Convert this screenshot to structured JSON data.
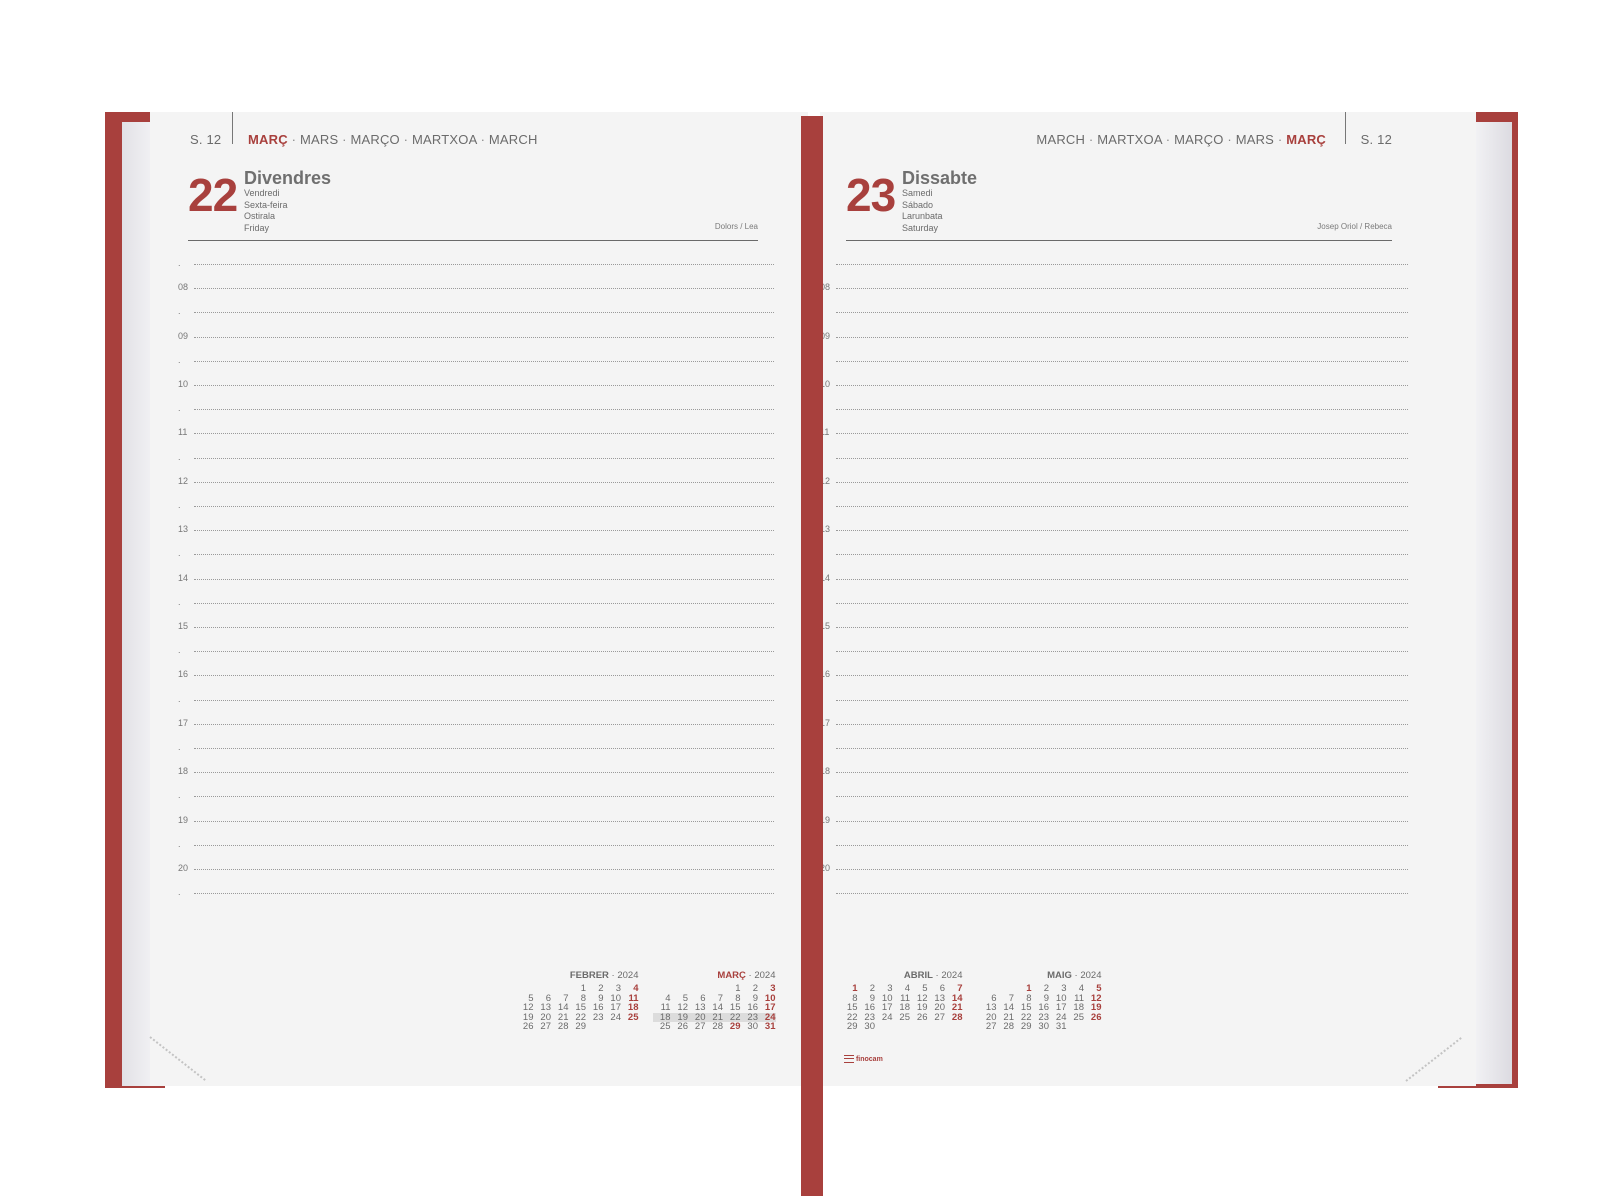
{
  "left_page": {
    "week": "S. 12",
    "header_months": [
      "MARÇ",
      "MARS",
      "MARÇO",
      "MARTXOA",
      "MARCH"
    ],
    "day_number": "22",
    "day_name": "Divendres",
    "alt_names": [
      "Vendredi",
      "Sexta-feira",
      "Ostirala",
      "Friday"
    ],
    "saints": "Dolors / Lea"
  },
  "right_page": {
    "week": "S. 12",
    "header_months": [
      "MARCH",
      "MARTXOA",
      "MARÇO",
      "MARS",
      "MARÇ"
    ],
    "day_number": "23",
    "day_name": "Dissabte",
    "alt_names": [
      "Samedi",
      "Sábado",
      "Larunbata",
      "Saturday"
    ],
    "saints": "Josep Oriol / Rebeca"
  },
  "schedule": {
    "rows": [
      ".",
      "08",
      ".",
      "09",
      ".",
      "10",
      ".",
      "11",
      ".",
      "12",
      ".",
      "13",
      ".",
      "14",
      ".",
      "15",
      ".",
      "16",
      ".",
      "17",
      ".",
      "18",
      ".",
      "19",
      ".",
      "20",
      "."
    ]
  },
  "mini_calendars": {
    "febrer": {
      "month": "FEBRER",
      "year": "2024",
      "weeks": [
        [
          "",
          "",
          "",
          "1",
          "2",
          "3",
          "4"
        ],
        [
          "5",
          "6",
          "7",
          "8",
          "9",
          "10",
          "11"
        ],
        [
          "12",
          "13",
          "14",
          "15",
          "16",
          "17",
          "18"
        ],
        [
          "19",
          "20",
          "21",
          "22",
          "23",
          "24",
          "25"
        ],
        [
          "26",
          "27",
          "28",
          "29",
          "",
          "",
          ""
        ]
      ]
    },
    "marc": {
      "month": "MARÇ",
      "year": "2024",
      "weeks": [
        [
          "",
          "",
          "",
          "",
          "1",
          "2",
          "3"
        ],
        [
          "4",
          "5",
          "6",
          "7",
          "8",
          "9",
          "10"
        ],
        [
          "11",
          "12",
          "13",
          "14",
          "15",
          "16",
          "17"
        ],
        [
          "18",
          "19",
          "20",
          "21",
          "22",
          "23",
          "24"
        ],
        [
          "25",
          "26",
          "27",
          "28",
          "29",
          "30",
          "31"
        ]
      ],
      "highlight_week": 3,
      "holiday": "29"
    },
    "abril": {
      "month": "ABRIL",
      "year": "2024",
      "weeks": [
        [
          "1",
          "2",
          "3",
          "4",
          "5",
          "6",
          "7"
        ],
        [
          "8",
          "9",
          "10",
          "11",
          "12",
          "13",
          "14"
        ],
        [
          "15",
          "16",
          "17",
          "18",
          "19",
          "20",
          "21"
        ],
        [
          "22",
          "23",
          "24",
          "25",
          "26",
          "27",
          "28"
        ],
        [
          "29",
          "30",
          "",
          "",
          "",
          "",
          ""
        ]
      ],
      "holiday": "1"
    },
    "maig": {
      "month": "MAIG",
      "year": "2024",
      "weeks": [
        [
          "",
          "",
          "1",
          "2",
          "3",
          "4",
          "5"
        ],
        [
          "6",
          "7",
          "8",
          "9",
          "10",
          "11",
          "12"
        ],
        [
          "13",
          "14",
          "15",
          "16",
          "17",
          "18",
          "19"
        ],
        [
          "20",
          "21",
          "22",
          "23",
          "24",
          "25",
          "26"
        ],
        [
          "27",
          "28",
          "29",
          "30",
          "31",
          "",
          ""
        ]
      ],
      "holiday": "1"
    }
  },
  "brand": "finocam",
  "colors": {
    "accent": "#a8403d",
    "paper": "#f4f4f4"
  }
}
